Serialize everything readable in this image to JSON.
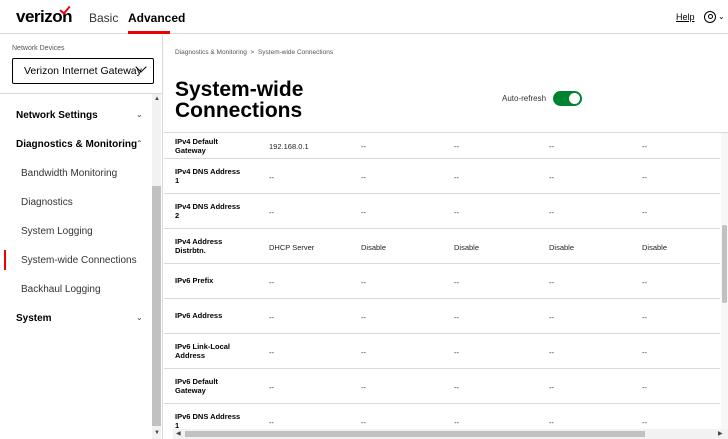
{
  "header": {
    "logo": "verizon",
    "tabs": [
      {
        "label": "Basic"
      },
      {
        "label": "Advanced"
      }
    ],
    "help_label": "Help",
    "brand_color": "#EE0000"
  },
  "sidebar": {
    "network_devices_label": "Network Devices",
    "selected_device": "Verizon Internet Gateway",
    "items": [
      {
        "label": "Network Settings",
        "type": "section"
      },
      {
        "label": "Diagnostics & Monitoring",
        "type": "section"
      },
      {
        "label": "Bandwidth Monitoring",
        "type": "sub"
      },
      {
        "label": "Diagnostics",
        "type": "sub"
      },
      {
        "label": "System Logging",
        "type": "sub"
      },
      {
        "label": "System-wide Connections",
        "type": "sub",
        "active": true
      },
      {
        "label": "Backhaul Logging",
        "type": "sub"
      },
      {
        "label": "System",
        "type": "section"
      }
    ]
  },
  "main": {
    "breadcrumb": [
      "Diagnostics & Monitoring",
      "System-wide Connections"
    ],
    "title": "System-wide Connections",
    "auto_refresh_label": "Auto-refresh",
    "auto_refresh_on": true,
    "toggle_color": "#008331",
    "rows": [
      {
        "header": "IPv4 Default Gateway",
        "values": [
          "192.168.0.1",
          "--",
          "--",
          "--",
          "--"
        ]
      },
      {
        "header": "IPv4 DNS Address 1",
        "values": [
          "--",
          "--",
          "--",
          "--",
          "--"
        ]
      },
      {
        "header": "IPv4 DNS Address 2",
        "values": [
          "--",
          "--",
          "--",
          "--",
          "--"
        ]
      },
      {
        "header": "IPv4 Address Distrbtn.",
        "values": [
          "DHCP Server",
          "Disable",
          "Disable",
          "Disable",
          "Disable"
        ]
      },
      {
        "header": "IPv6 Prefix",
        "values": [
          "--",
          "--",
          "--",
          "--",
          "--"
        ]
      },
      {
        "header": "IPv6 Address",
        "values": [
          "--",
          "--",
          "--",
          "--",
          "--"
        ]
      },
      {
        "header": "IPv6 Link-Local Address",
        "values": [
          "--",
          "--",
          "--",
          "--",
          "--"
        ]
      },
      {
        "header": "IPv6 Default Gateway",
        "values": [
          "--",
          "--",
          "--",
          "--",
          "--"
        ]
      },
      {
        "header": "IPv6 DNS Address 1",
        "values": [
          "--",
          "--",
          "--",
          "--",
          "--"
        ]
      }
    ]
  }
}
